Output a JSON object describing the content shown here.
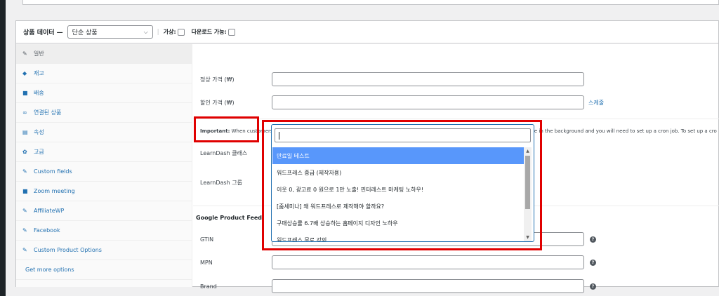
{
  "header": {
    "title": "상품 데이터 —",
    "product_type": "단순 상품",
    "sep": "|",
    "virtual_label": "가상:",
    "downloadable_label": "다운로드 가능:"
  },
  "tabs": [
    {
      "icon": "✎",
      "label": "일반"
    },
    {
      "icon": "◆",
      "label": "재고"
    },
    {
      "icon": "■",
      "label": "배송"
    },
    {
      "icon": "∞",
      "label": "연결된 상품"
    },
    {
      "icon": "▤",
      "label": "속성"
    },
    {
      "icon": "✿",
      "label": "고급"
    },
    {
      "icon": "✎",
      "label": "Custom fields"
    },
    {
      "icon": "■",
      "label": "Zoom meeting"
    },
    {
      "icon": "✎",
      "label": "AffiliateWP"
    },
    {
      "icon": "✎",
      "label": "Facebook"
    },
    {
      "icon": "✎",
      "label": "Custom Product Options"
    },
    {
      "label": "Get more options"
    }
  ],
  "general": {
    "regular_price_label": "정상 가격 (₩)",
    "sale_price_label": "할인 가격 (₩)",
    "schedule_link": "스케줄",
    "notice_strong": "Important:",
    "notice_text": " When customers checkout with 5 or more associated courses and groups in a single cart, course enrollment process is done in the background and you will need to set up a cron job. To set up a cro",
    "learndash_courses_label": "LearnDash 클래스",
    "learndash_groups_label": "LearnDash 그룹",
    "google_feed_title": "Google Product Feed",
    "gtin_label": "GTIN",
    "mpn_label": "MPN",
    "brand_label": "Brand",
    "help_icon": "?"
  },
  "dropdown": {
    "search_value": "",
    "items": [
      "만료일 테스트",
      "워드프레스 중급 (제작자용)",
      "이웃 0, 광고료 0 원으로 1만 노출! 핀터레스트 마케팅 노하우!",
      "[줌세미나] 왜 워드프레스로 제작해야 할까요?",
      "구매상승률 6.7배 상승하는 홈페이지 디자인 노하우",
      "워드프레스 무료 강의"
    ],
    "selected_index": 0,
    "scroll_up": "▲",
    "scroll_down": "▼"
  },
  "colors": {
    "highlight": "#e00000",
    "selected_item": "#5897fb",
    "link": "#2271b1"
  }
}
